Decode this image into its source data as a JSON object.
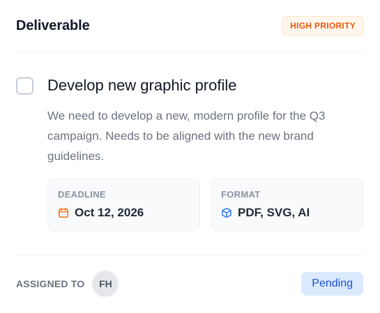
{
  "header": {
    "title": "Deliverable",
    "priority": "HIGH PRIORITY"
  },
  "task": {
    "title": "Develop new graphic profile",
    "description": "We need to develop a new, modern profile for the Q3 campaign. Needs to be aligned with the new brand guidelines.",
    "completed": false
  },
  "meta": {
    "deadline": {
      "label": "DEADLINE",
      "value": "Oct 12, 2026",
      "icon": "calendar-icon"
    },
    "format": {
      "label": "FORMAT",
      "value": "PDF, SVG, AI",
      "icon": "cube-icon"
    }
  },
  "footer": {
    "assigned_label": "ASSIGNED TO",
    "assignee_initials": "FH",
    "status": "Pending"
  },
  "colors": {
    "priority": "#ea580c",
    "status": "#1d4ed8",
    "calendar_icon": "#f97316",
    "cube_icon": "#3b82f6"
  }
}
